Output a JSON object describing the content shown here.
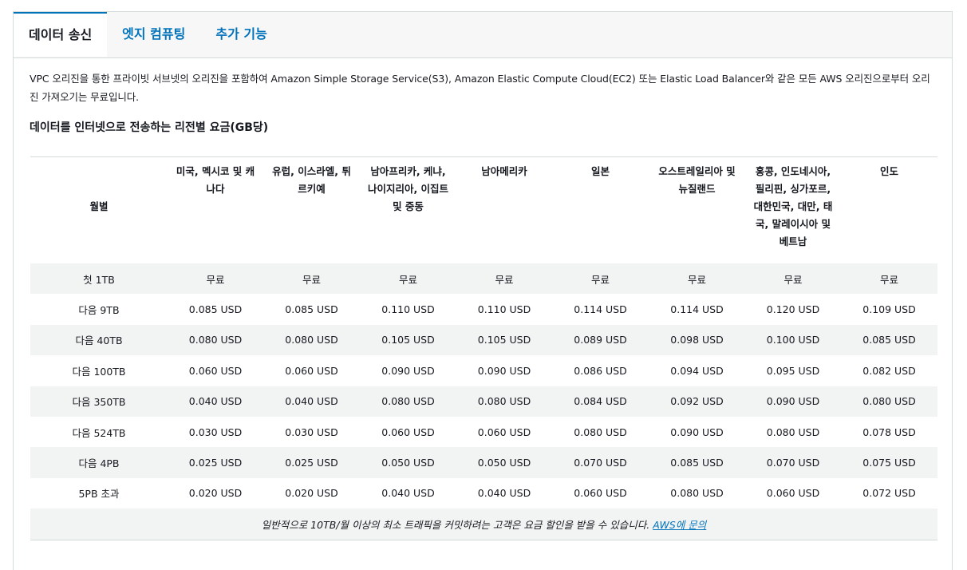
{
  "tabs": [
    "데이터 송신",
    "엣지 컴퓨팅",
    "추가 기능"
  ],
  "intro": "VPC 오리진을 통한 프라이빗 서브넷의 오리진을 포함하여 Amazon Simple Storage Service(S3), Amazon Elastic Compute Cloud(EC2) 또는 Elastic Load Balancer와 같은 모든 AWS 오리진으로부터 오리진 가져오기는 무료입니다.",
  "section_title": "데이터를 인터넷으로 전송하는 리전별 요금(GB당)",
  "table": {
    "headers": [
      "월별",
      "미국, 멕시코 및 캐나다",
      "유럽, 이스라엘, 튀르키예",
      "남아프리카, 케냐, 나이지리아, 이집트 및 중동",
      "남아메리카",
      "일본",
      "오스트레일리아 및 뉴질랜드",
      "홍콩, 인도네시아, 필리핀, 싱가포르, 대한민국, 대만, 태국, 말레이시아 및 베트남",
      "인도"
    ],
    "rows": [
      [
        "첫 1TB",
        "무료",
        "무료",
        "무료",
        "무료",
        "무료",
        "무료",
        "무료",
        "무료"
      ],
      [
        "다음 9TB",
        "0.085 USD",
        "0.085 USD",
        "0.110 USD",
        "0.110 USD",
        "0.114 USD",
        "0.114 USD",
        "0.120 USD",
        "0.109 USD"
      ],
      [
        "다음 40TB",
        "0.080 USD",
        "0.080 USD",
        "0.105 USD",
        "0.105 USD",
        "0.089 USD",
        "0.098 USD",
        "0.100 USD",
        "0.085 USD"
      ],
      [
        "다음 100TB",
        "0.060 USD",
        "0.060 USD",
        "0.090 USD",
        "0.090 USD",
        "0.086 USD",
        "0.094 USD",
        "0.095 USD",
        "0.082 USD"
      ],
      [
        "다음 350TB",
        "0.040 USD",
        "0.040 USD",
        "0.080 USD",
        "0.080 USD",
        "0.084 USD",
        "0.092 USD",
        "0.090 USD",
        "0.080 USD"
      ],
      [
        "다음 524TB",
        "0.030 USD",
        "0.030 USD",
        "0.060 USD",
        "0.060 USD",
        "0.080 USD",
        "0.090 USD",
        "0.080 USD",
        "0.078 USD"
      ],
      [
        "다음 4PB",
        "0.025 USD",
        "0.025 USD",
        "0.050 USD",
        "0.050 USD",
        "0.070 USD",
        "0.085 USD",
        "0.070 USD",
        "0.075 USD"
      ],
      [
        "5PB 초과",
        "0.020 USD",
        "0.020 USD",
        "0.040 USD",
        "0.040 USD",
        "0.060 USD",
        "0.080 USD",
        "0.060 USD",
        "0.072 USD"
      ]
    ],
    "note_text": "일반적으로 10TB/월 이상의 최소 트래픽을 커밋하려는 고객은 요금 할인을 받을 수 있습니다. ",
    "note_link": "AWS에 문의"
  },
  "colors": {
    "accent": "#0073bb",
    "row_shade": "#f2f3f3",
    "border": "#d5dbdb"
  }
}
